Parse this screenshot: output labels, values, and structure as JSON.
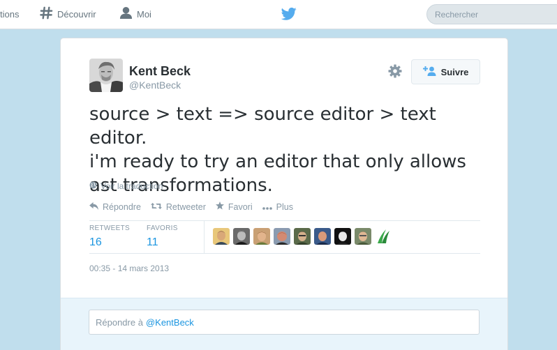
{
  "nav": {
    "notifications_label": "tions",
    "discover_label": "Découvrir",
    "me_label": "Moi",
    "search_placeholder": "Rechercher"
  },
  "tweet": {
    "author_name": "Kent Beck",
    "author_handle": "@KentBeck",
    "follow_label": "Suivre",
    "text": "source > text => source editor > text editor.\ni'm ready to try an editor that only allows\nast transformations.",
    "translate_label": "Voir la traduction",
    "actions": {
      "reply": "Répondre",
      "retweet": "Retweeter",
      "favorite": "Favori",
      "more": "Plus"
    },
    "stats": {
      "retweets_label": "RETWEETS",
      "retweets_count": "16",
      "favorites_label": "FAVORIS",
      "favorites_count": "11"
    },
    "timestamp": "00:35 - 14 mars 2013"
  },
  "reply": {
    "prefix": "Répondre à",
    "mention": "@KentBeck"
  },
  "icons": {
    "nav_notifications": "partial-nav-icon",
    "nav_discover": "hashtag-icon",
    "nav_me": "person-icon",
    "logo": "twitter-bird-icon",
    "settings": "gear-icon",
    "follow": "add-person-icon",
    "translate": "globe-icon",
    "reply": "reply-icon",
    "retweet": "retweet-icon",
    "favorite": "star-icon",
    "more": "more-dots-icon"
  },
  "colors": {
    "background": "#c0deed",
    "brand_blue": "#55acee",
    "link_blue": "#1b95e0",
    "muted_text": "#8899a6",
    "reply_area": "#e8f4fb"
  }
}
